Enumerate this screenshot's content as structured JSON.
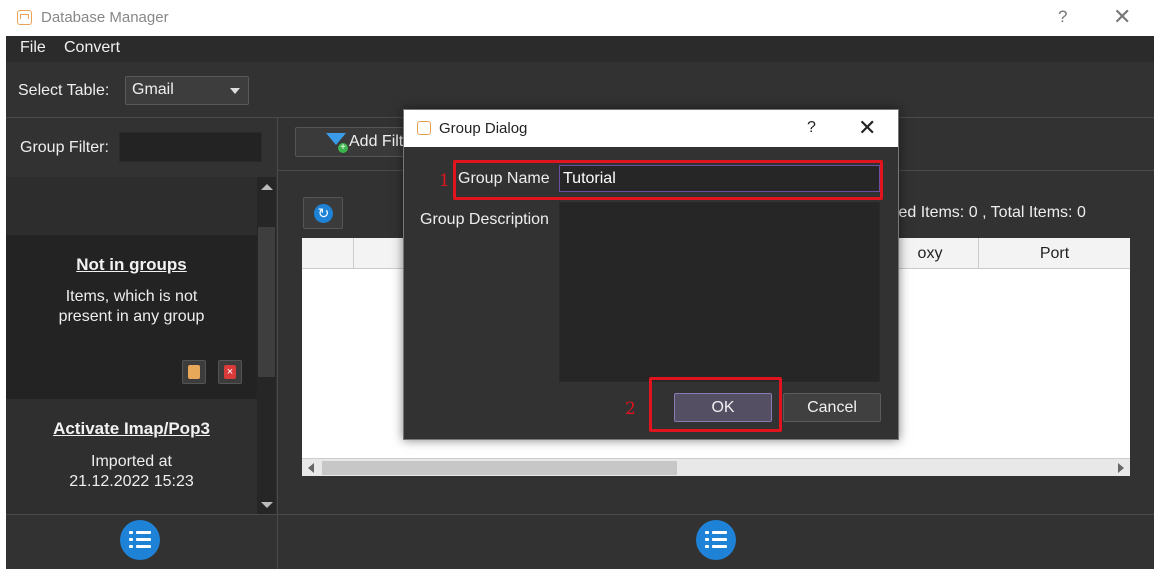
{
  "window": {
    "title": "Database Manager",
    "help": "?",
    "close": "✕"
  },
  "menu": [
    "File",
    "Convert"
  ],
  "select_table": {
    "label": "Select Table:",
    "value": "Gmail"
  },
  "group_filter": {
    "label": "Group Filter:",
    "value": ""
  },
  "groups": [
    {
      "name": "Not in groups",
      "description_lines": [
        "Items, which is not",
        "present in any group"
      ]
    },
    {
      "name": "Activate Imap/Pop3",
      "description_lines": [
        "Imported at",
        "21.12.2022 15:23"
      ]
    }
  ],
  "toolbar": {
    "add_filter_label": "Add Filt"
  },
  "counts": {
    "selected_label": "cted Items:",
    "selected": "0",
    "separator": ",",
    "total_label": "Total Items:",
    "total": "0"
  },
  "table": {
    "columns": [
      "",
      "",
      "oxy",
      "Port"
    ]
  },
  "dialog": {
    "title": "Group Dialog",
    "help": "?",
    "close": "✕",
    "group_name_label": "Group Name",
    "group_name_value": "Tutorial",
    "group_description_label": "Group Description",
    "group_description_value": "",
    "ok_label": "OK",
    "cancel_label": "Cancel"
  },
  "annotations": {
    "step1": "1",
    "step2": "2"
  },
  "colors": {
    "accent_blue": "#1e82d6",
    "highlight_red": "#e0141e",
    "dark_bg": "#323232"
  }
}
